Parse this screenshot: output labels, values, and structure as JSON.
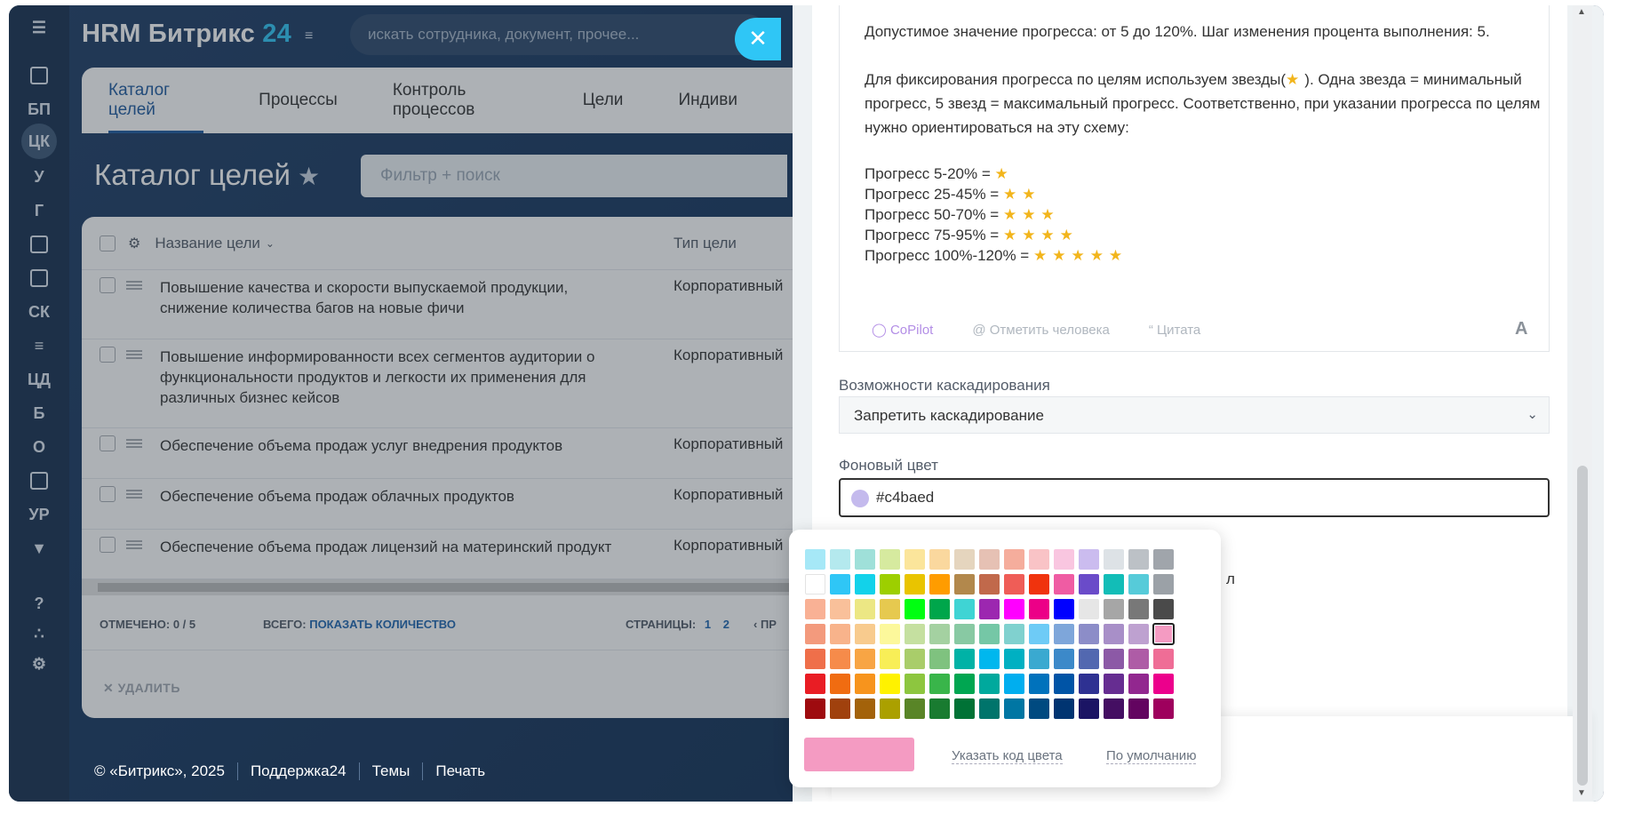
{
  "header": {
    "logo_text": "HRM Битрикс",
    "logo_num": "24",
    "search_placeholder": "искать сотрудника, документ, прочее..."
  },
  "rail": {
    "items": [
      "БП",
      "ЦК",
      "У",
      "Г",
      "СК",
      "ЦД",
      "Б",
      "О",
      "УР"
    ]
  },
  "tabs": [
    "Каталог целей",
    "Процессы",
    "Контроль процессов",
    "Цели",
    "Индиви"
  ],
  "page": {
    "title": "Каталог целей",
    "filter_placeholder": "Фильтр + поиск"
  },
  "grid": {
    "col_name": "Название цели",
    "col_type": "Тип цели",
    "rows": [
      {
        "name": "Повышение качества и скорости выпускаемой продукции, снижение количества багов на новые фичи",
        "type": "Корпоративный"
      },
      {
        "name": "Повышение информированности всех сегментов аудитории о функциональности продуктов и легкости их применения для различных бизнес кейсов",
        "type": "Корпоративный"
      },
      {
        "name": "Обеспечение объема продаж услуг внедрения продуктов",
        "type": "Корпоративный"
      },
      {
        "name": "Обеспечение объема продаж облачных продуктов",
        "type": "Корпоративный"
      },
      {
        "name": "Обеспечение объема продаж лицензий на материнский продукт",
        "type": "Корпоративный"
      }
    ],
    "marked_label": "ОТМЕЧЕНО:",
    "marked_value": "0 / 5",
    "total_label": "ВСЕГО:",
    "total_link": "ПОКАЗАТЬ КОЛИЧЕСТВО",
    "pages_label": "СТРАНИЦЫ:",
    "page1": "1",
    "page2": "2",
    "prev": "‹ ПР",
    "delete": "УДАЛИТЬ"
  },
  "footer": {
    "copyright": "© «Битрикс», 2025",
    "support": "Поддержка24",
    "themes": "Темы",
    "print": "Печать"
  },
  "editor": {
    "line1": "Допустимое значение прогресса: от 5 до 120%. Шаг изменения процента выполнения: 5.",
    "line2a": "Для фиксирования прогресса по целям используем звезды(",
    "line2b": "). Одна звезда = минимальный прогресс, 5 звезд = максимальный прогресс. Соответственно, при указании прогресса по целям нужно ориентироваться на эту схему:",
    "p1": "Прогресс 5-20% =",
    "p2": "Прогресс 25-45% =",
    "p3": "Прогресс 50-70% =",
    "p4": "Прогресс 75-95% =",
    "p5": "Прогресс 100%-120% =",
    "s1": "★",
    "s2": "★★",
    "s3": "★★★",
    "s4": "★★★★",
    "s5": "★★★★★",
    "copilot": "CoPilot",
    "mention": "Отметить человека",
    "quote": "Цитата",
    "font": "A"
  },
  "form": {
    "cascade_label": "Возможности каскадирования",
    "cascade_value": "Запретить каскадирование",
    "bg_label": "Фоновый цвет",
    "bg_value": "#c4baed"
  },
  "palette": {
    "code_link": "Указать код цвета",
    "default_link": "По умолчанию",
    "preview_color": "#f49bc2",
    "colors": [
      "#a6e8f7",
      "#b4e9ee",
      "#9fe0d9",
      "#d6ea9f",
      "#fbe59b",
      "#fad89e",
      "#e5d5be",
      "#e6c1b4",
      "#f5ad9c",
      "#f9c3c6",
      "#f9c6e0",
      "#cbbcef",
      "#dde2e6",
      "#bcc1c6",
      "#a0a5ab",
      "#ffffff",
      "#2fc6f6",
      "#12d2ea",
      "#9dcf00",
      "#e9c400",
      "#ff9c00",
      "#b2884c",
      "#c1694b",
      "#ef5d57",
      "#f0330d",
      "#ef5ca3",
      "#6a4bc9",
      "#12bdb7",
      "#56cbd9",
      "#9ba1a7",
      "#f9b195",
      "#f9c09a",
      "#ece784",
      "#e6c94f",
      "#00ff11",
      "#00a64b",
      "#3fd4d4",
      "#9c27b0",
      "#ff00ff",
      "#ec0087",
      "#0000ff",
      "#e6e6e6",
      "#a6a6a6",
      "#787878",
      "#4a4a4a",
      "#f39a7d",
      "#f8b38b",
      "#f8cb8e",
      "#fcf89b",
      "#c5e0a0",
      "#a4d1a1",
      "#88c9a3",
      "#75c7a6",
      "#80d1cf",
      "#6ecbf6",
      "#7ea6da",
      "#8c8dc8",
      "#a88fc8",
      "#bea1d0",
      "#f49bc2",
      "#ef6f4a",
      "#f68b4a",
      "#f8a544",
      "#f8ee57",
      "#a9cd6a",
      "#7fc27f",
      "#00b2a6",
      "#00b7ee",
      "#00b0c2",
      "#3aa9d0",
      "#3c89c9",
      "#5268b0",
      "#8c59a6",
      "#ae5ca6",
      "#ef6d96",
      "#e91d24",
      "#f06c11",
      "#f7941d",
      "#fff200",
      "#8dc63f",
      "#39b54a",
      "#00a651",
      "#00a99d",
      "#00aeef",
      "#0072bc",
      "#0054a6",
      "#2e3192",
      "#662d91",
      "#92278f",
      "#ec008c",
      "#9e0b0f",
      "#a0410d",
      "#a3620a",
      "#aba000",
      "#598527",
      "#197b30",
      "#007236",
      "#00746b",
      "#0076a3",
      "#004a80",
      "#003471",
      "#1b1464",
      "#440e62",
      "#630460",
      "#9e005d"
    ]
  },
  "peek": "л"
}
